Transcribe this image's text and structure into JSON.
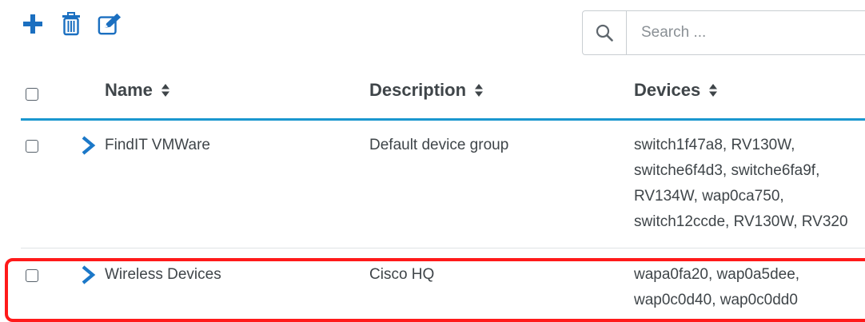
{
  "toolbar": {
    "icons": [
      "plus-icon",
      "trash-icon",
      "edit-icon"
    ]
  },
  "search": {
    "placeholder": "Search ...",
    "icon": "search-icon"
  },
  "table": {
    "columns": [
      "Name",
      "Description",
      "Devices"
    ],
    "rows": [
      {
        "name": "FindIT VMWare",
        "description": "Default device group",
        "devices": [
          "switch1f47a8, RV130W,",
          "switche6f4d3, switche6fa9f,",
          "RV134W, wap0ca750,",
          "switch12ccde, RV130W, RV320"
        ]
      },
      {
        "name": "Wireless Devices",
        "description": "Cisco HQ",
        "devices": [
          "wapa0fa20, wap0a5dee,",
          "wap0c0d40, wap0c0dd0"
        ]
      }
    ]
  },
  "colors": {
    "accent": "#1b97cf",
    "highlight": "#ff1a1a",
    "text": "#3f4549"
  }
}
